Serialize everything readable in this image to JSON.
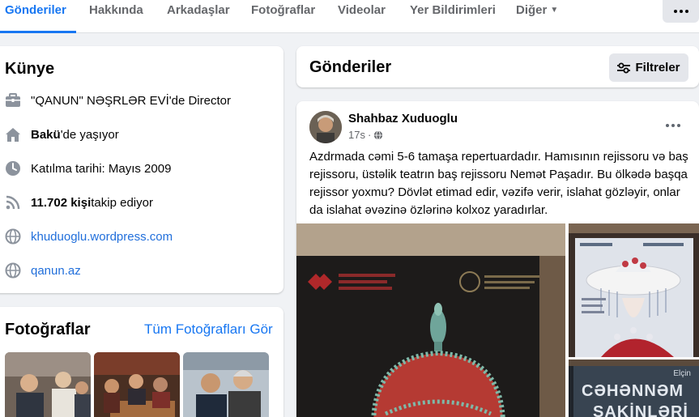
{
  "tabs": [
    {
      "label": "Gönderiler",
      "active": true
    },
    {
      "label": "Hakkında"
    },
    {
      "label": "Arkadaşlar"
    },
    {
      "label": "Fotoğraflar"
    },
    {
      "label": "Videolar"
    },
    {
      "label": "Yer Bildirimleri"
    },
    {
      "label": "Diğer",
      "caret": "▼"
    }
  ],
  "intro": {
    "title": "Künye",
    "work_org": "\"QANUN\" NƏŞRLƏR EVİ",
    "work_role": "'de Director",
    "city": "Bakü",
    "city_suffix": "'de yaşıyor",
    "joined": "Katılma tarihi: Mayıs 2009",
    "followers_count": "11.702 kişi",
    "followers_suffix": " takip ediyor",
    "website1": "khuduoglu.wordpress.com",
    "website2": "qanun.az"
  },
  "photos": {
    "title": "Fotoğraflar",
    "see_all": "Tüm Fotoğrafları Gör"
  },
  "posts_header": {
    "title": "Gönderiler",
    "filter_label": "Filtreler"
  },
  "post": {
    "author": "Shahbaz Xuduoglu",
    "time": "17s",
    "sep": "·",
    "text": "Azdrmada cəmi 5-6 tamaşa repertuardadır. Hamısının rejissoru və baş rejissoru, üstəlik teatrın baş rejissoru Nemət Paşadır. Bu ölkədə başqa rejissor yoxmu? Dövlət etimad edir, vəzifə verir, islahat gözləyir, onlar da islahat əvəzinə özlərinə kolxoz yaradırlar.",
    "poster_lines": [
      "Elçin",
      "CƏHƏNNƏM",
      "SAKİNLƏRİ"
    ]
  },
  "colors": {
    "accent": "#1877f2",
    "link": "#216fdb",
    "secondary_text": "#65676b",
    "page_bg": "#f0f2f5"
  },
  "icons": {
    "work": "briefcase-icon",
    "home": "house-icon",
    "clock": "clock-icon",
    "followers": "rss-icon",
    "web": "globe-icon",
    "privacy": "globe-icon",
    "filter": "sliders-icon"
  }
}
